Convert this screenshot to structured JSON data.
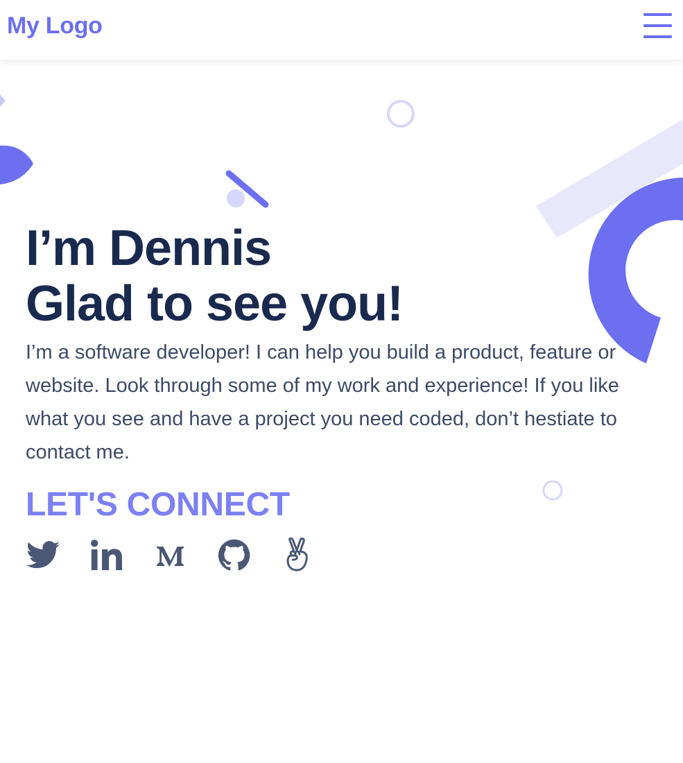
{
  "nav": {
    "logo": "My Logo",
    "menu_icon": "hamburger-menu-icon"
  },
  "hero": {
    "title_line1": "I’m Dennis",
    "title_line2": "Glad to see you!",
    "description": "I’m a software developer! I can help you build a product, feature or website. Look through some of my work and experience! If you like what you see and have a project you need coded, don’t hestiate to contact me."
  },
  "connect": {
    "heading": "LET'S CONNECT",
    "links": [
      {
        "name": "Twitter",
        "icon": "twitter-icon"
      },
      {
        "name": "LinkedIn",
        "icon": "linkedin-icon"
      },
      {
        "name": "Medium",
        "icon": "medium-icon"
      },
      {
        "name": "GitHub",
        "icon": "github-icon"
      },
      {
        "name": "AngelList",
        "icon": "angellist-icon"
      }
    ]
  },
  "colors": {
    "accent": "#6c6ff0",
    "accent_light": "#7d80f2",
    "heading": "#1a2a4f",
    "body_text": "#3d4a66",
    "icon": "#4a5875",
    "decoration_pale": "#e8e8fc"
  }
}
